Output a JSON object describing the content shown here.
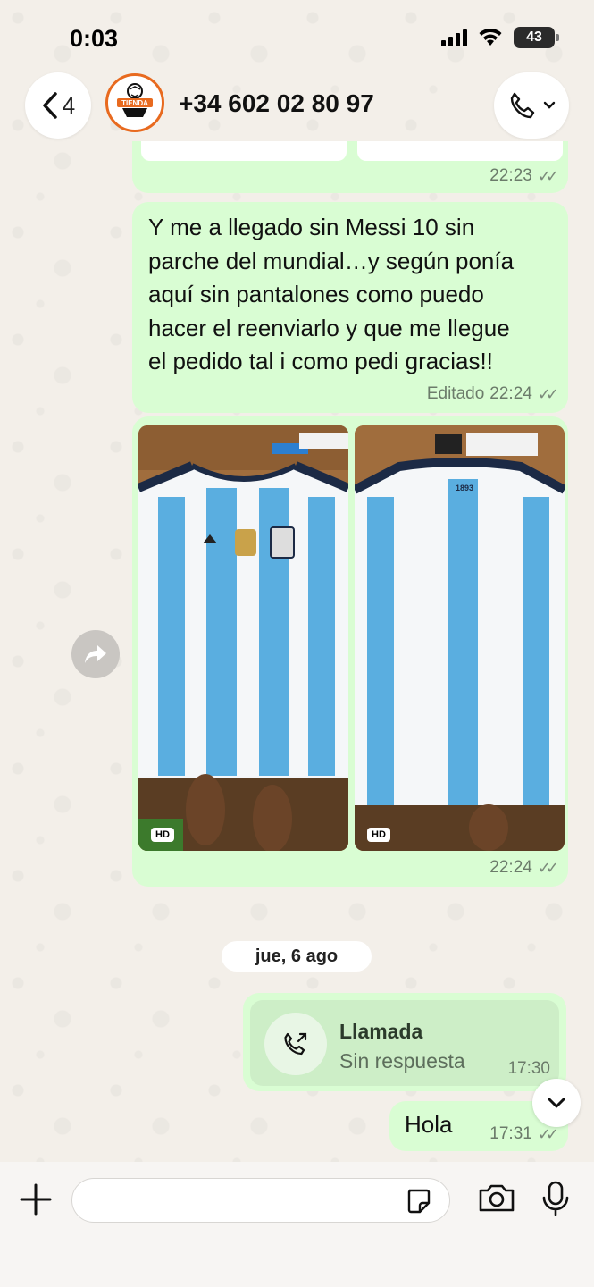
{
  "status_bar": {
    "time": "0:03",
    "battery": "43"
  },
  "header": {
    "back_count": "4",
    "contact": "+34 602 02 80 97",
    "avatar_text": "TIENDA"
  },
  "messages": {
    "m0": {
      "time": "22:23"
    },
    "m1": {
      "lines": [
        "Y  me a llegado sin Messi 10 sin",
        "parche del mundial…y según ponía",
        "aquí sin pantalones como puedo",
        "hacer el reenviarlo y que me llegue",
        "el pedido tal i como pedi gracias!!"
      ],
      "edited": "Editado",
      "time": "22:24"
    },
    "m2": {
      "hd1": "HD",
      "hd2": "HD",
      "shirt_back_number": "1893",
      "time": "22:24"
    }
  },
  "date_separator": "jue, 6 ago",
  "call": {
    "title": "Llamada",
    "subtitle": "Sin respuesta",
    "time": "17:30"
  },
  "hola": {
    "text": "Hola",
    "time": "17:31"
  },
  "ticks": "✓✓",
  "colors": {
    "outgoing_bubble": "#d9fdd3",
    "stripe_blue": "#5aaee0",
    "floor_wood": "#9b6a3b"
  }
}
